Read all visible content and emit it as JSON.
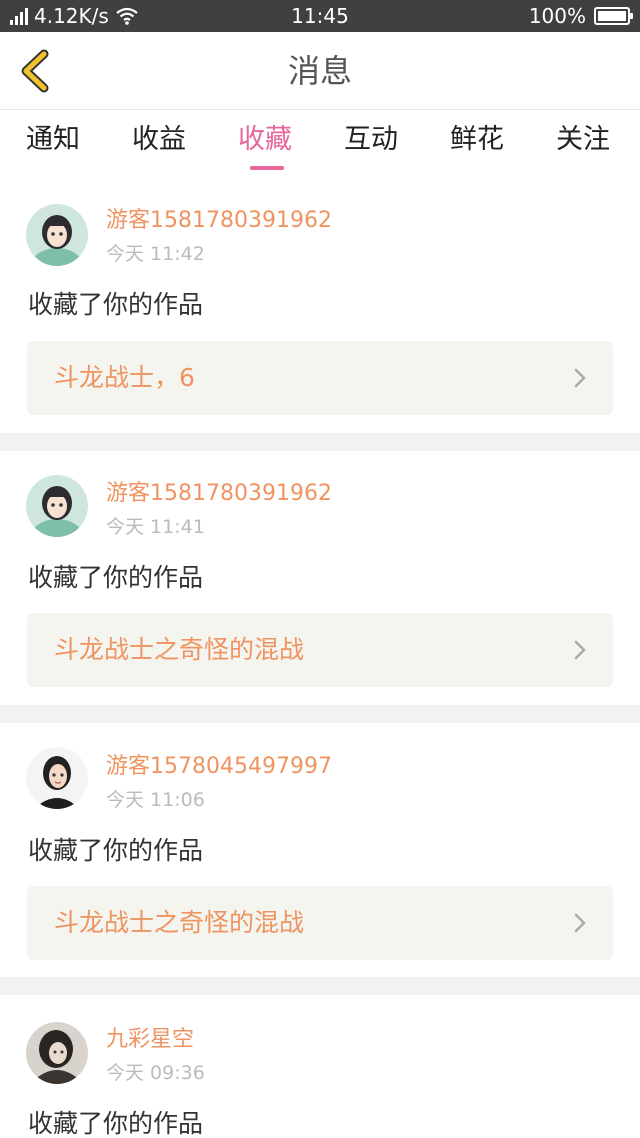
{
  "status_bar": {
    "network_type": "4G",
    "net_speed": "4.12K/s",
    "time": "11:45",
    "battery": "100%",
    "battery_level": 1.0
  },
  "header": {
    "title": "消息",
    "back_icon": "chevron-left-icon",
    "accent_color": "#f2c12e"
  },
  "tabs": {
    "items": [
      {
        "label": "通知"
      },
      {
        "label": "收益"
      },
      {
        "label": "收藏"
      },
      {
        "label": "互动"
      },
      {
        "label": "鲜花"
      },
      {
        "label": "关注"
      }
    ],
    "active_index": 2,
    "active_color": "#e5679b"
  },
  "messages": [
    {
      "username": "游客1581780391962",
      "time": "今天 11:42",
      "action": "收藏了你的作品",
      "work_title": "斗龙战士，6"
    },
    {
      "username": "游客1581780391962",
      "time": "今天 11:41",
      "action": "收藏了你的作品",
      "work_title": "斗龙战士之奇怪的混战"
    },
    {
      "username": "游客1578045497997",
      "time": "今天 11:06",
      "action": "收藏了你的作品",
      "work_title": "斗龙战士之奇怪的混战"
    },
    {
      "username": "九彩星空",
      "time": "今天 09:36",
      "action": "收藏了你的作品",
      "work_title": ""
    }
  ],
  "colors": {
    "username": "#ef9461",
    "work_title": "#ef9461",
    "divider": "#f2f2f0"
  }
}
